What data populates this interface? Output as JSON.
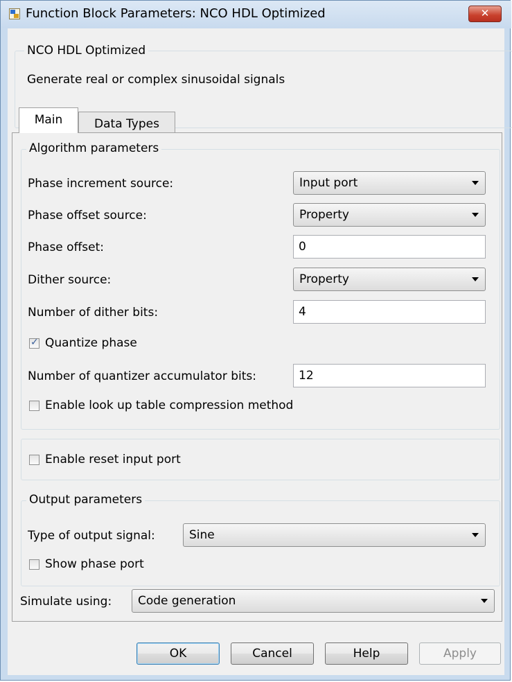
{
  "window": {
    "title": "Function Block Parameters: NCO HDL Optimized",
    "close_glyph": "✕"
  },
  "description": {
    "group_title": "NCO HDL Optimized",
    "text": "Generate real or complex sinusoidal signals"
  },
  "tabs": [
    {
      "label": "Main",
      "active": true
    },
    {
      "label": "Data Types",
      "active": false
    }
  ],
  "algorithm": {
    "group_title": "Algorithm parameters",
    "phase_increment_source": {
      "label": "Phase increment source:",
      "value": "Input port"
    },
    "phase_offset_source": {
      "label": "Phase offset source:",
      "value": "Property"
    },
    "phase_offset": {
      "label": "Phase offset:",
      "value": "0"
    },
    "dither_source": {
      "label": "Dither source:",
      "value": "Property"
    },
    "dither_bits": {
      "label": "Number of dither bits:",
      "value": "4"
    },
    "quantize_phase": {
      "label": "Quantize phase",
      "checked": true
    },
    "quantizer_bits": {
      "label": "Number of quantizer accumulator bits:",
      "value": "12"
    },
    "lut_compression": {
      "label": "Enable look up table compression method",
      "checked": false
    }
  },
  "reset": {
    "enable_reset": {
      "label": "Enable reset input port",
      "checked": false
    }
  },
  "output": {
    "group_title": "Output parameters",
    "output_signal": {
      "label": "Type of output signal:",
      "value": "Sine"
    },
    "show_phase_port": {
      "label": "Show phase port",
      "checked": false
    }
  },
  "simulate": {
    "label": "Simulate using:",
    "value": "Code generation"
  },
  "buttons": {
    "ok": "OK",
    "cancel": "Cancel",
    "help": "Help",
    "apply": "Apply"
  },
  "checkmark_glyph": "✓",
  "colors": {
    "title_bar": "#c9dbee",
    "close_button": "#c8402c",
    "dialog_bg": "#f0f0f0"
  }
}
